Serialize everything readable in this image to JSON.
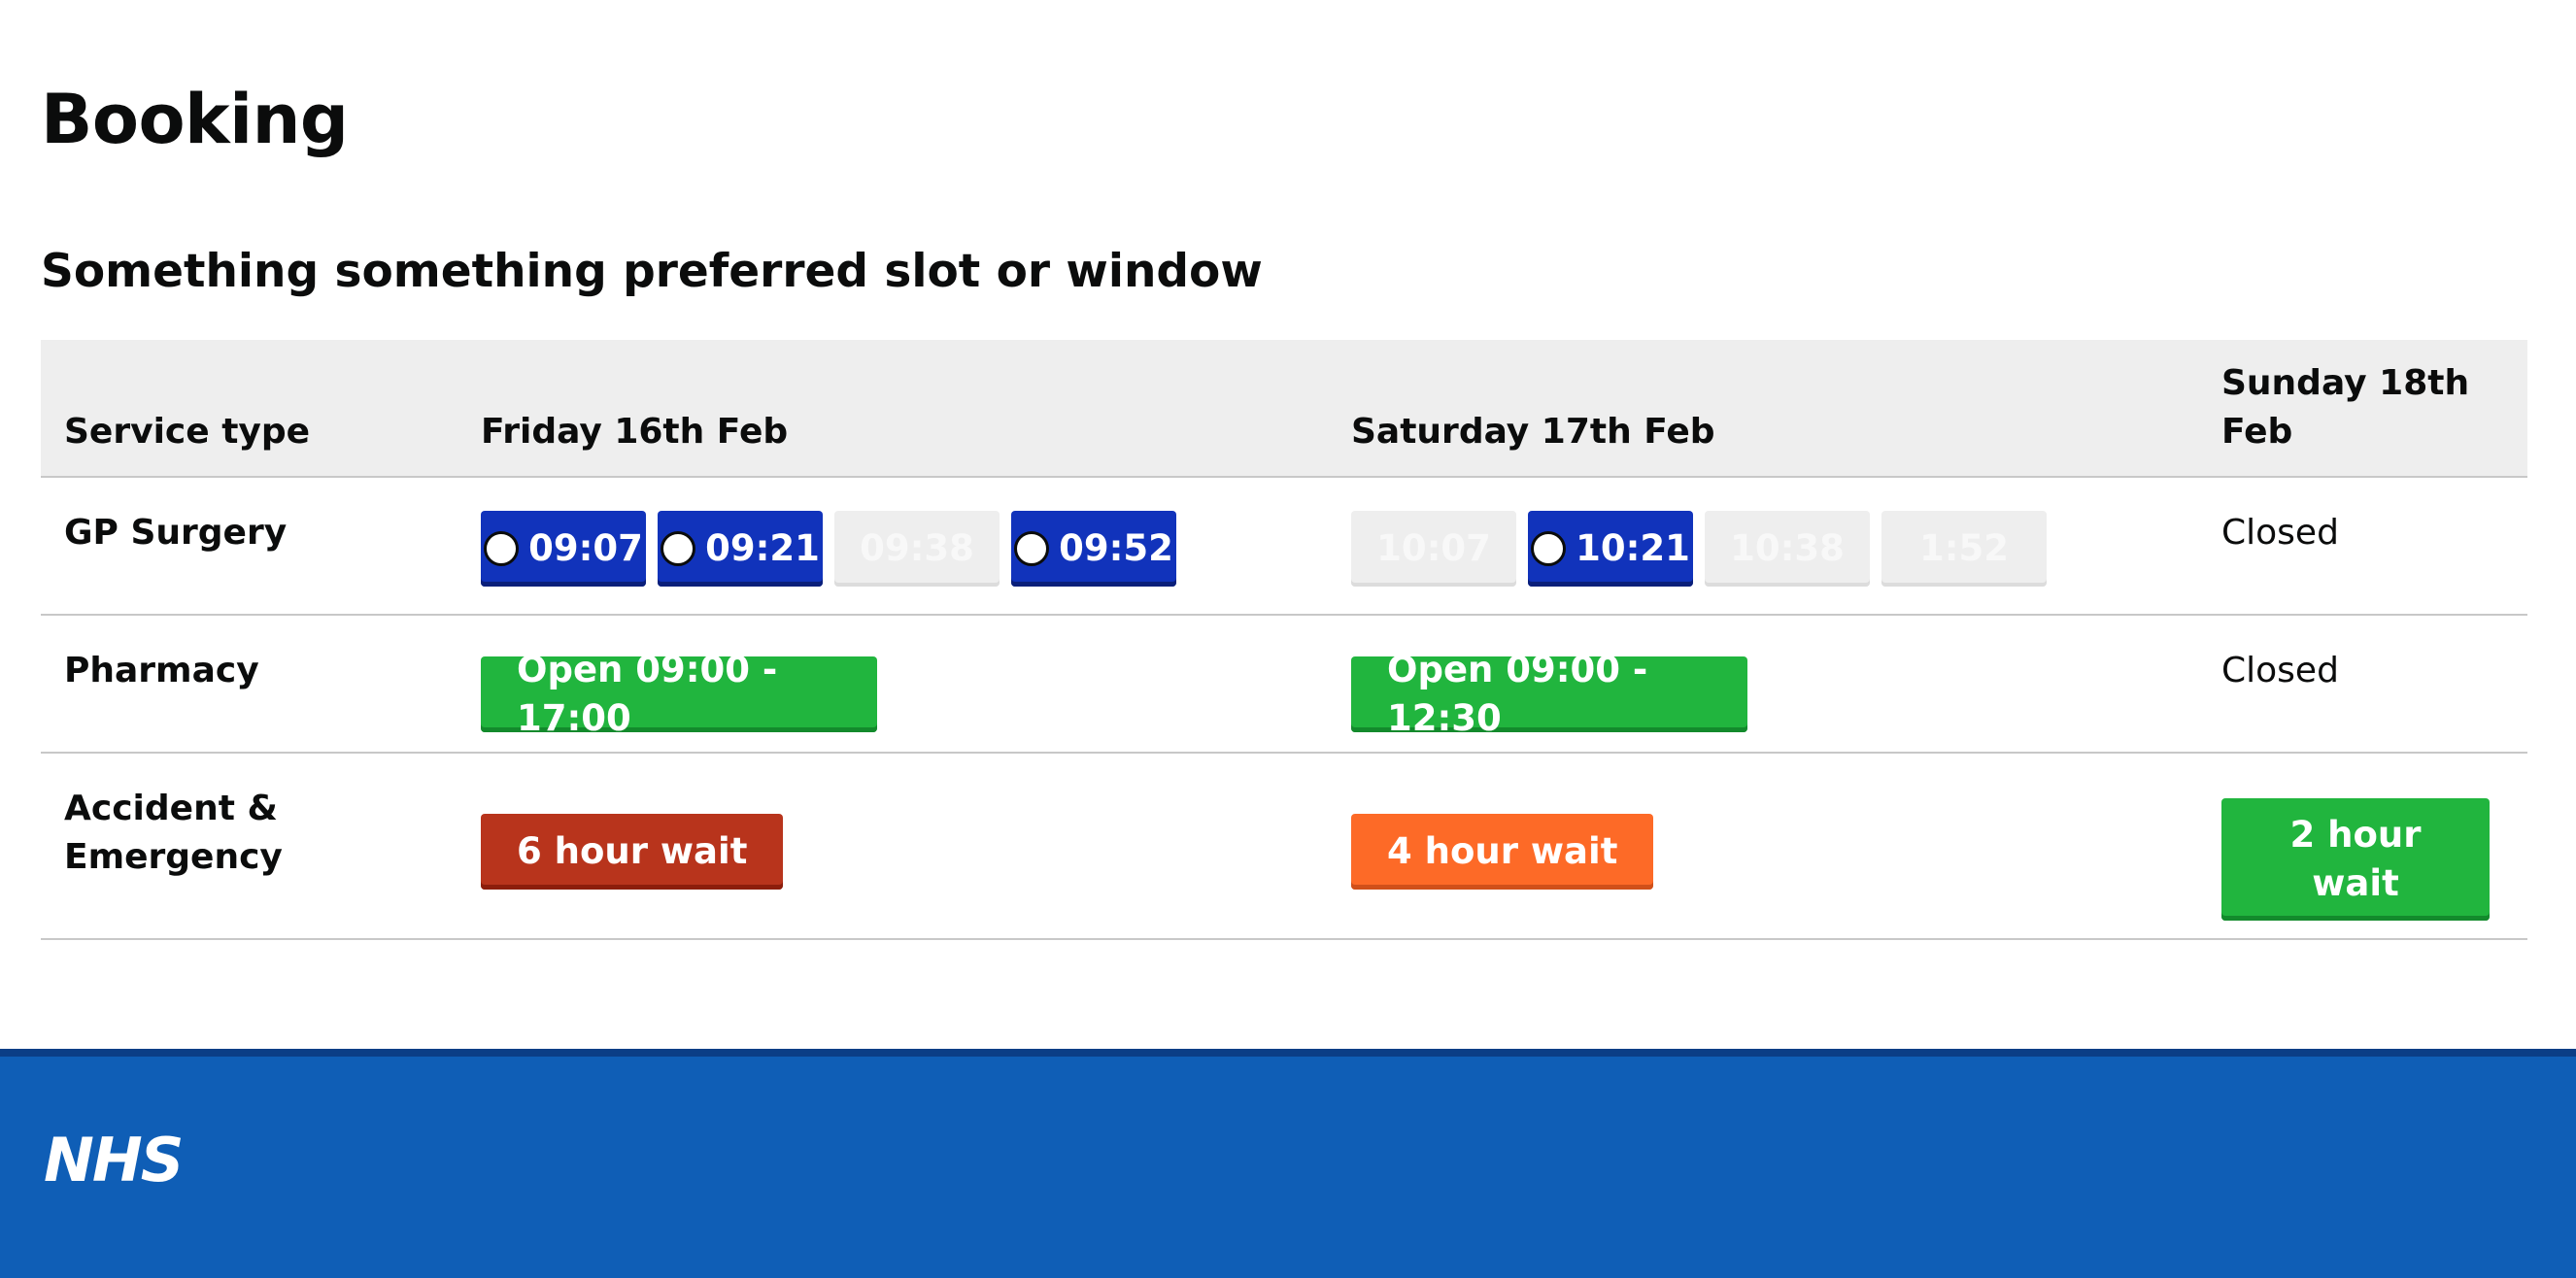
{
  "page": {
    "title": "Booking",
    "subtitle": "Something something preferred slot or window"
  },
  "table": {
    "headers": [
      "Service type",
      "Friday 16th Feb",
      "Saturday 17th Feb",
      "Sunday 18th Feb"
    ],
    "rows": {
      "gp": {
        "service": "GP Surgery",
        "friday_slots": [
          {
            "time": "09:07",
            "available": true
          },
          {
            "time": "09:21",
            "available": true
          },
          {
            "time": "09:38",
            "available": false
          },
          {
            "time": "09:52",
            "available": true
          }
        ],
        "saturday_slots": [
          {
            "time": "10:07",
            "available": false
          },
          {
            "time": "10:21",
            "available": true
          },
          {
            "time": "10:38",
            "available": false
          },
          {
            "time": "1:52",
            "available": false
          }
        ],
        "sunday": "Closed"
      },
      "pharmacy": {
        "service": "Pharmacy",
        "friday": "Open 09:00 - 17:00",
        "saturday": "Open 09:00 - 12:30",
        "sunday": "Closed"
      },
      "ae": {
        "service": "Accident & Emergency",
        "friday": "6 hour wait",
        "saturday": "4 hour wait",
        "sunday": "2 hour wait"
      }
    }
  },
  "colors": {
    "slot_available": "#1133bb",
    "slot_unavailable": "#eeeeee",
    "status_green": "#21b53e",
    "status_red": "#b8341c",
    "status_orange": "#fd6a27",
    "footer": "#0f5eb6"
  },
  "footer": {
    "logo": "NHS"
  }
}
